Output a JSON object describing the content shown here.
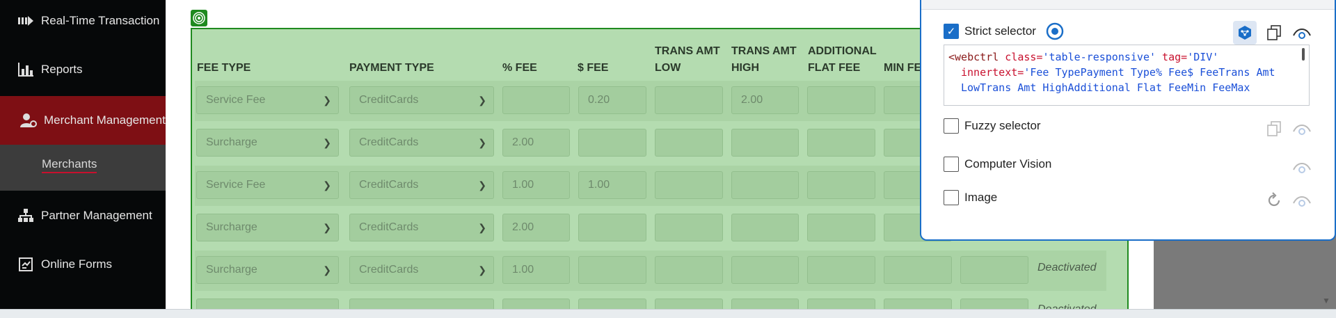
{
  "sidebar": {
    "items": [
      {
        "label": "Real-Time Transaction",
        "icon": "transactions-icon"
      },
      {
        "label": "Reports",
        "icon": "bar-chart-icon"
      },
      {
        "label": "Merchant Management",
        "icon": "user-gear-icon",
        "active": true
      },
      {
        "label": "Merchants",
        "sub": true
      },
      {
        "label": "Partner Management",
        "icon": "org-chart-icon"
      },
      {
        "label": "Online Forms",
        "icon": "form-icon"
      }
    ]
  },
  "table": {
    "headers": [
      "FEE TYPE",
      "PAYMENT TYPE",
      "% FEE",
      "$ FEE",
      "TRANS AMT\nLOW",
      "TRANS AMT\nHIGH",
      "ADDITIONAL\nFLAT FEE",
      "MIN FE"
    ],
    "rows": [
      {
        "fee_type": "Service Fee",
        "payment_type": "CreditCards",
        "pct_fee": "",
        "dollar_fee": "0.20",
        "low": "",
        "high": "2.00",
        "status": ""
      },
      {
        "fee_type": "Surcharge",
        "payment_type": "CreditCards",
        "pct_fee": "2.00",
        "dollar_fee": "",
        "low": "",
        "high": "",
        "status": ""
      },
      {
        "fee_type": "Service Fee",
        "payment_type": "CreditCards",
        "pct_fee": "1.00",
        "dollar_fee": "1.00",
        "low": "",
        "high": "",
        "status": ""
      },
      {
        "fee_type": "Surcharge",
        "payment_type": "CreditCards",
        "pct_fee": "2.00",
        "dollar_fee": "",
        "low": "",
        "high": "",
        "status": ""
      },
      {
        "fee_type": "Surcharge",
        "payment_type": "CreditCards",
        "pct_fee": "1.00",
        "dollar_fee": "",
        "low": "",
        "high": "",
        "status": "Deactivated"
      },
      {
        "fee_type": "",
        "payment_type": "",
        "pct_fee": "",
        "dollar_fee": "",
        "low": "",
        "high": "",
        "status": "Deactivated"
      }
    ]
  },
  "panel": {
    "strict_label": "Strict selector",
    "strict_checked": true,
    "selector_code": {
      "line1_tag": "<webctrl",
      "line1_attr1": " class=",
      "line1_val1": "'table-responsive'",
      "line1_attr2": " tag=",
      "line1_val2": "'DIV'",
      "line2_attr": "innertext=",
      "line2_val": "'Fee TypePayment Type% Fee$ FeeTrans Amt",
      "line3_val": "LowTrans Amt HighAdditional Flat FeeMin FeeMax"
    },
    "fuzzy_label": "Fuzzy selector",
    "cv_label": "Computer Vision",
    "image_label": "Image"
  },
  "colors": {
    "sidebar_bg": "#060809",
    "active_item": "#7e0f14",
    "highlight_green": "#1f8a1f",
    "checkbox_blue": "#1a6ec8"
  }
}
